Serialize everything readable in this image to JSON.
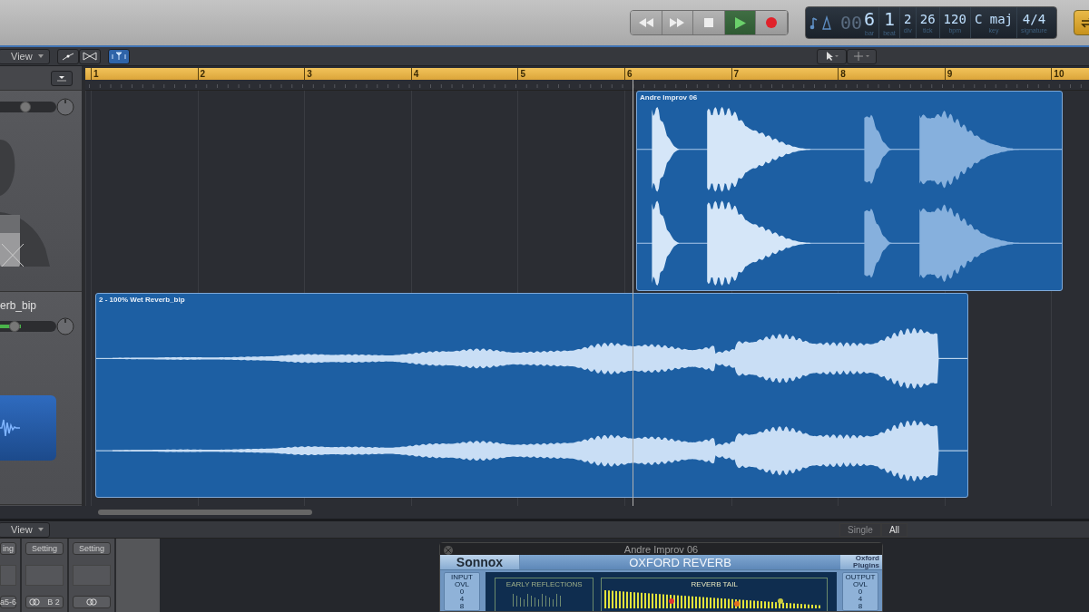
{
  "transport": {
    "buttons": [
      {
        "kind": "rewind",
        "active": false
      },
      {
        "kind": "forward",
        "active": false
      },
      {
        "kind": "stop",
        "active": false
      },
      {
        "kind": "play",
        "active": true
      },
      {
        "kind": "record",
        "active": false
      }
    ]
  },
  "lcd": {
    "dim_prefix": "00",
    "fields": [
      {
        "value": "6",
        "label": "bar"
      },
      {
        "value": "1",
        "label": "beat"
      },
      {
        "value": "2",
        "label": "div"
      },
      {
        "value": "26",
        "label": "tick"
      },
      {
        "value": "120",
        "label": "bpm"
      },
      {
        "value": "C maj",
        "label": "key"
      },
      {
        "value": "4/4",
        "label": "signature"
      }
    ]
  },
  "cycle": {
    "on": true
  },
  "toolbar": {
    "view_menu": "View",
    "catch_on": true
  },
  "ruler": {
    "bars": [
      "1",
      "2",
      "3",
      "4",
      "5",
      "6",
      "7",
      "8",
      "9",
      "10"
    ]
  },
  "tracks": [
    {
      "volume": {
        "level": 0.45
      }
    },
    {
      "name": "erb_bip",
      "volume": {
        "level": 0.25
      }
    }
  ],
  "regions": [
    {
      "title": "Andre Improv 06",
      "kind": "notes"
    },
    {
      "title": "2 - 100% Wet Reverb_bip",
      "kind": "swell"
    }
  ],
  "bottom": {
    "view_menu": "View",
    "strips": [
      {
        "setting": "ing",
        "send": "a5-6",
        "linked": false
      },
      {
        "setting": "Setting",
        "send": "B 2",
        "linked": true
      },
      {
        "setting": "Setting",
        "linked": true
      }
    ],
    "view_buttons": [
      "Single",
      "All"
    ]
  },
  "plugin": {
    "window_title": "Andre Improv 06",
    "brand": "Sonnox",
    "product": "OXFORD REVERB",
    "badge_top": "Oxford",
    "badge_bottom": "Plugins",
    "input_label": "INPUT",
    "output_label": "OUTPUT",
    "input_scale": [
      "OVL",
      "0",
      "4",
      "8"
    ],
    "output_scale": [
      "OVL",
      "0",
      "4",
      "8"
    ],
    "early_label": "EARLY REFLECTIONS",
    "tail_label": "REVERB TAIL"
  }
}
